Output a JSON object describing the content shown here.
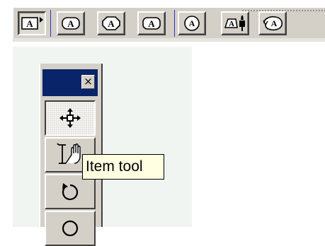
{
  "toolbar": {
    "buttons": [
      {
        "name": "text-style-plain-button",
        "icon": "letter-a-box-icon",
        "label": "A",
        "pressed": true
      },
      {
        "name": "text-style-rounded-button",
        "icon": "letter-a-rounded-icon",
        "label": "A"
      },
      {
        "name": "text-style-octagon-button",
        "icon": "letter-a-octagon-icon",
        "label": "A"
      },
      {
        "name": "text-style-rounded-alt-button",
        "icon": "letter-a-rounded-icon",
        "label": "A"
      },
      {
        "name": "text-style-circle-button",
        "icon": "letter-a-circle-icon",
        "label": "A"
      },
      {
        "name": "text-style-pin-button",
        "icon": "letter-a-pin-icon",
        "label": "A"
      },
      {
        "name": "text-style-swirl-button",
        "icon": "letter-a-swirl-icon",
        "label": "A"
      }
    ]
  },
  "palette": {
    "close_label": "×",
    "tools": [
      {
        "name": "move-tool-button",
        "icon": "four-arrow-move-icon",
        "pressed": true
      },
      {
        "name": "item-tool-button",
        "icon": "hand-pointer-icon"
      },
      {
        "name": "rotate-tool-button",
        "icon": "rotate-icon"
      },
      {
        "name": "next-tool-button",
        "icon": "circle-icon"
      }
    ]
  },
  "tooltip": {
    "text": "Item tool"
  },
  "colors": {
    "face": "#d4d0c8",
    "titlebar": "#0a246a",
    "tooltip_bg": "#ffffe1",
    "divider": "#2a34c4"
  }
}
